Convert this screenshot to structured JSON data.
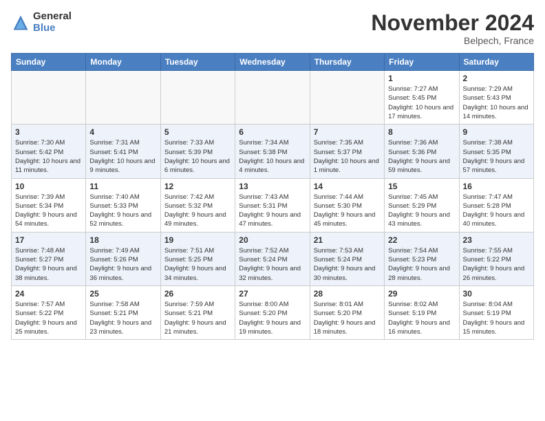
{
  "logo": {
    "general": "General",
    "blue": "Blue"
  },
  "header": {
    "month": "November 2024",
    "location": "Belpech, France"
  },
  "weekdays": [
    "Sunday",
    "Monday",
    "Tuesday",
    "Wednesday",
    "Thursday",
    "Friday",
    "Saturday"
  ],
  "weeks": [
    [
      {
        "day": "",
        "info": ""
      },
      {
        "day": "",
        "info": ""
      },
      {
        "day": "",
        "info": ""
      },
      {
        "day": "",
        "info": ""
      },
      {
        "day": "",
        "info": ""
      },
      {
        "day": "1",
        "info": "Sunrise: 7:27 AM\nSunset: 5:45 PM\nDaylight: 10 hours and 17 minutes."
      },
      {
        "day": "2",
        "info": "Sunrise: 7:29 AM\nSunset: 5:43 PM\nDaylight: 10 hours and 14 minutes."
      }
    ],
    [
      {
        "day": "3",
        "info": "Sunrise: 7:30 AM\nSunset: 5:42 PM\nDaylight: 10 hours and 11 minutes."
      },
      {
        "day": "4",
        "info": "Sunrise: 7:31 AM\nSunset: 5:41 PM\nDaylight: 10 hours and 9 minutes."
      },
      {
        "day": "5",
        "info": "Sunrise: 7:33 AM\nSunset: 5:39 PM\nDaylight: 10 hours and 6 minutes."
      },
      {
        "day": "6",
        "info": "Sunrise: 7:34 AM\nSunset: 5:38 PM\nDaylight: 10 hours and 4 minutes."
      },
      {
        "day": "7",
        "info": "Sunrise: 7:35 AM\nSunset: 5:37 PM\nDaylight: 10 hours and 1 minute."
      },
      {
        "day": "8",
        "info": "Sunrise: 7:36 AM\nSunset: 5:36 PM\nDaylight: 9 hours and 59 minutes."
      },
      {
        "day": "9",
        "info": "Sunrise: 7:38 AM\nSunset: 5:35 PM\nDaylight: 9 hours and 57 minutes."
      }
    ],
    [
      {
        "day": "10",
        "info": "Sunrise: 7:39 AM\nSunset: 5:34 PM\nDaylight: 9 hours and 54 minutes."
      },
      {
        "day": "11",
        "info": "Sunrise: 7:40 AM\nSunset: 5:33 PM\nDaylight: 9 hours and 52 minutes."
      },
      {
        "day": "12",
        "info": "Sunrise: 7:42 AM\nSunset: 5:32 PM\nDaylight: 9 hours and 49 minutes."
      },
      {
        "day": "13",
        "info": "Sunrise: 7:43 AM\nSunset: 5:31 PM\nDaylight: 9 hours and 47 minutes."
      },
      {
        "day": "14",
        "info": "Sunrise: 7:44 AM\nSunset: 5:30 PM\nDaylight: 9 hours and 45 minutes."
      },
      {
        "day": "15",
        "info": "Sunrise: 7:45 AM\nSunset: 5:29 PM\nDaylight: 9 hours and 43 minutes."
      },
      {
        "day": "16",
        "info": "Sunrise: 7:47 AM\nSunset: 5:28 PM\nDaylight: 9 hours and 40 minutes."
      }
    ],
    [
      {
        "day": "17",
        "info": "Sunrise: 7:48 AM\nSunset: 5:27 PM\nDaylight: 9 hours and 38 minutes."
      },
      {
        "day": "18",
        "info": "Sunrise: 7:49 AM\nSunset: 5:26 PM\nDaylight: 9 hours and 36 minutes."
      },
      {
        "day": "19",
        "info": "Sunrise: 7:51 AM\nSunset: 5:25 PM\nDaylight: 9 hours and 34 minutes."
      },
      {
        "day": "20",
        "info": "Sunrise: 7:52 AM\nSunset: 5:24 PM\nDaylight: 9 hours and 32 minutes."
      },
      {
        "day": "21",
        "info": "Sunrise: 7:53 AM\nSunset: 5:24 PM\nDaylight: 9 hours and 30 minutes."
      },
      {
        "day": "22",
        "info": "Sunrise: 7:54 AM\nSunset: 5:23 PM\nDaylight: 9 hours and 28 minutes."
      },
      {
        "day": "23",
        "info": "Sunrise: 7:55 AM\nSunset: 5:22 PM\nDaylight: 9 hours and 26 minutes."
      }
    ],
    [
      {
        "day": "24",
        "info": "Sunrise: 7:57 AM\nSunset: 5:22 PM\nDaylight: 9 hours and 25 minutes."
      },
      {
        "day": "25",
        "info": "Sunrise: 7:58 AM\nSunset: 5:21 PM\nDaylight: 9 hours and 23 minutes."
      },
      {
        "day": "26",
        "info": "Sunrise: 7:59 AM\nSunset: 5:21 PM\nDaylight: 9 hours and 21 minutes."
      },
      {
        "day": "27",
        "info": "Sunrise: 8:00 AM\nSunset: 5:20 PM\nDaylight: 9 hours and 19 minutes."
      },
      {
        "day": "28",
        "info": "Sunrise: 8:01 AM\nSunset: 5:20 PM\nDaylight: 9 hours and 18 minutes."
      },
      {
        "day": "29",
        "info": "Sunrise: 8:02 AM\nSunset: 5:19 PM\nDaylight: 9 hours and 16 minutes."
      },
      {
        "day": "30",
        "info": "Sunrise: 8:04 AM\nSunset: 5:19 PM\nDaylight: 9 hours and 15 minutes."
      }
    ]
  ]
}
